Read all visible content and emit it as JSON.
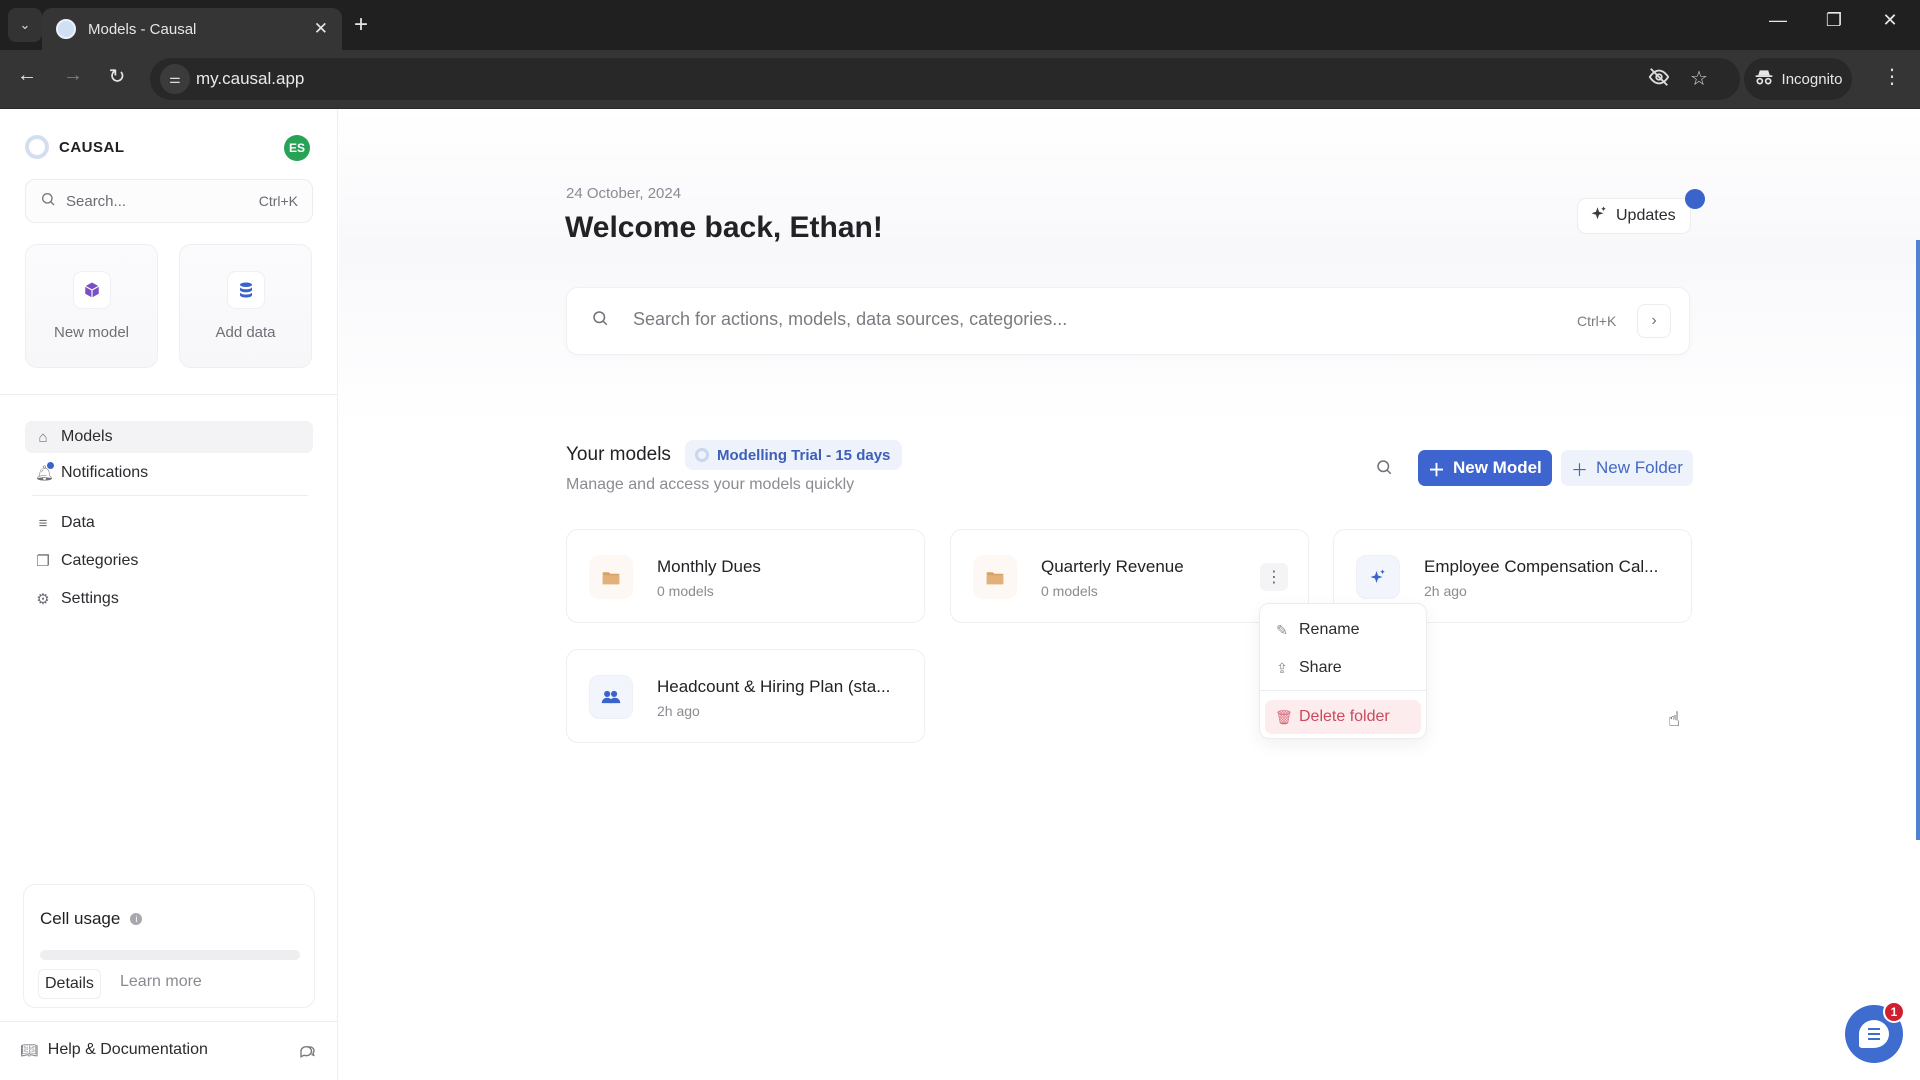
{
  "browser": {
    "tab_title": "Models - Causal",
    "url": "my.causal.app",
    "incognito_label": "Incognito",
    "icons": {
      "tab_list": "chevron-down-icon",
      "tab_close": "close-icon",
      "new_tab": "plus-icon",
      "back": "arrow-left-icon",
      "forward": "arrow-right-icon",
      "reload": "reload-icon",
      "site_info": "tune-icon",
      "eye_off": "eye-off-icon",
      "bookmark": "star-icon",
      "incognito": "incognito-icon",
      "menu": "more-vertical-icon"
    }
  },
  "sidebar": {
    "brand": "CAUSAL",
    "avatar_initials": "ES",
    "search": {
      "placeholder": "Search...",
      "shortcut": "Ctrl+K"
    },
    "quick_actions": [
      {
        "label": "New model",
        "icon": "cube-icon",
        "color": "#7a4fc4"
      },
      {
        "label": "Add data",
        "icon": "database-icon",
        "color": "#3b63cc"
      }
    ],
    "nav": [
      {
        "label": "Models",
        "icon": "home-icon",
        "active": true
      },
      {
        "label": "Notifications",
        "icon": "bell-icon",
        "has_dot": true
      },
      {
        "label": "Data",
        "icon": "database-icon"
      },
      {
        "label": "Categories",
        "icon": "copy-icon"
      },
      {
        "label": "Settings",
        "icon": "gear-icon"
      }
    ],
    "cell_usage": {
      "title": "Cell usage",
      "progress_percent": 0,
      "details_label": "Details",
      "learn_more_label": "Learn more"
    },
    "help_label": "Help & Documentation"
  },
  "main": {
    "date": "24 October, 2024",
    "welcome": "Welcome back, Ethan!",
    "updates_label": "Updates",
    "search": {
      "placeholder": "Search for actions, models, data sources, categories...",
      "shortcut": "Ctrl+K"
    },
    "models_section": {
      "title": "Your models",
      "trial_badge": "Modelling Trial - 15 days",
      "subtitle": "Manage and access your models quickly",
      "new_model_label": "New Model",
      "new_folder_label": "New Folder"
    },
    "cards": [
      {
        "title": "Monthly Dues",
        "subtitle": "0 models",
        "type": "folder"
      },
      {
        "title": "Quarterly Revenue",
        "subtitle": "0 models",
        "type": "folder"
      },
      {
        "title": "Employee Compensation Cal...",
        "subtitle": "2h ago",
        "type": "model",
        "icon": "sparkle-icon"
      },
      {
        "title": "Headcount & Hiring Plan (sta...",
        "subtitle": "2h ago",
        "type": "model",
        "icon": "users-icon"
      }
    ],
    "context_menu": {
      "items": [
        {
          "label": "Rename",
          "icon": "pencil-icon"
        },
        {
          "label": "Share",
          "icon": "share-icon"
        },
        {
          "label": "Delete folder",
          "icon": "trash-icon",
          "danger": true
        }
      ]
    }
  },
  "chat": {
    "badge_count": "1"
  },
  "colors": {
    "accent": "#3d64cf",
    "avatar": "#28a356",
    "danger": "#c94a5b",
    "folder": "#d9a066"
  }
}
